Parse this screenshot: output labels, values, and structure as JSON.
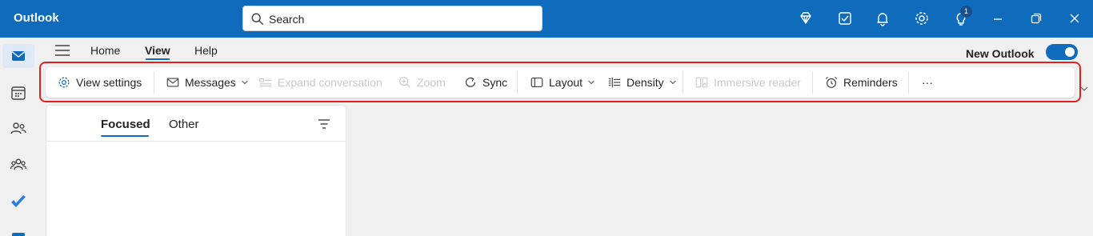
{
  "app": {
    "title": "Outlook"
  },
  "search": {
    "placeholder": "Search"
  },
  "titlebar": {
    "icons": [
      "premium-diamond-icon",
      "my-day-icon",
      "notifications-bell-icon",
      "settings-gear-icon",
      "tips-lightbulb-icon",
      "minimize-icon",
      "restore-icon",
      "close-icon"
    ],
    "tips_badge": "1"
  },
  "menu": {
    "tabs": [
      {
        "label": "Home",
        "active": false
      },
      {
        "label": "View",
        "active": true
      },
      {
        "label": "Help",
        "active": false
      }
    ],
    "new_outlook_label": "New Outlook",
    "new_outlook_enabled": true
  },
  "ribbon": {
    "view_settings": "View settings",
    "messages": "Messages",
    "expand_conversation": "Expand conversation",
    "zoom": "Zoom",
    "sync": "Sync",
    "layout": "Layout",
    "density": "Density",
    "immersive_reader": "Immersive reader",
    "reminders": "Reminders",
    "more": "···"
  },
  "rail": {
    "items": [
      "mail-icon",
      "calendar-icon",
      "people-icon",
      "groups-icon",
      "todo-check-icon",
      "apps-icon"
    ]
  },
  "list": {
    "tabs": [
      {
        "label": "Focused",
        "active": true
      },
      {
        "label": "Other",
        "active": false
      }
    ]
  },
  "colors": {
    "accent": "#0f6cbd",
    "highlight": "#e02020"
  }
}
